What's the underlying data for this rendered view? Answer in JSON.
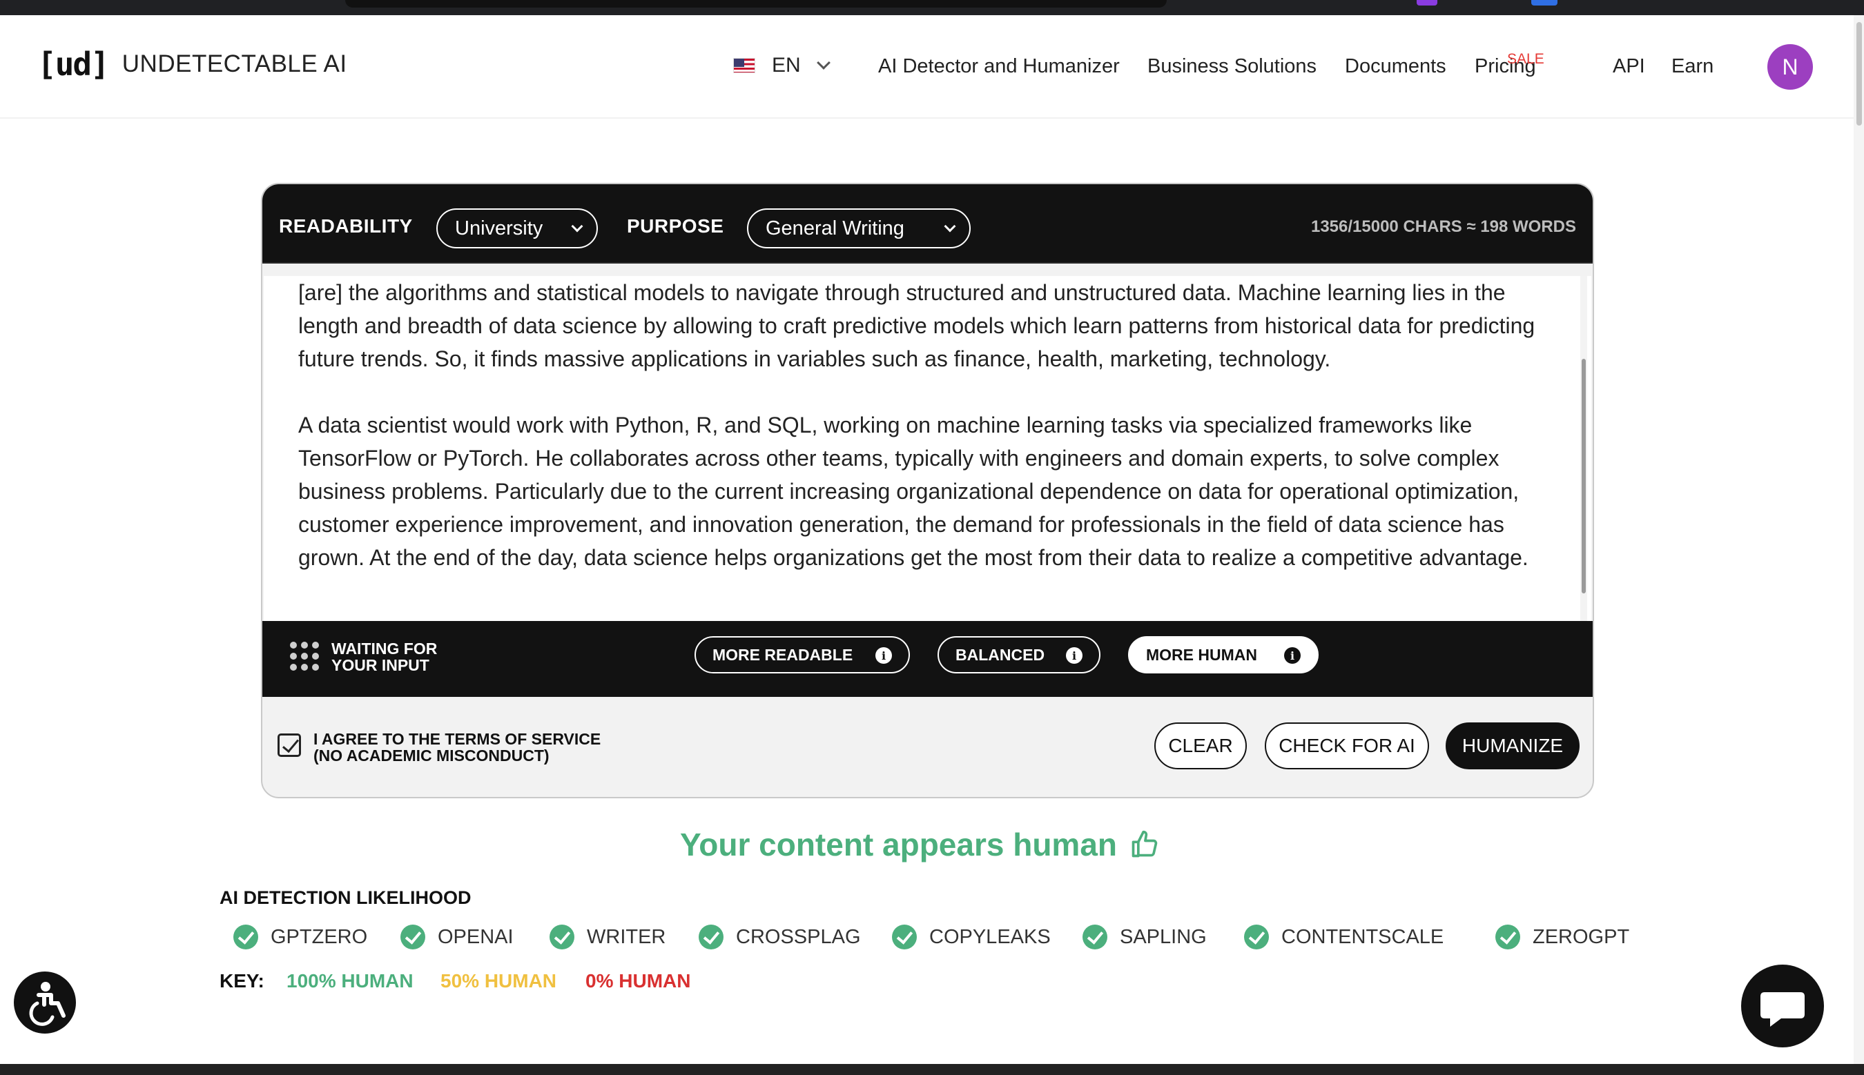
{
  "brand": {
    "mark": "[ud]",
    "name": "UNDETECTABLE AI"
  },
  "language": {
    "code": "EN",
    "flag": "us-flag"
  },
  "nav": {
    "items": [
      "AI Detector and Humanizer",
      "Business Solutions",
      "Documents",
      "Pricing",
      "API",
      "Earn"
    ],
    "sale_badge": "SALE",
    "avatar_initial": "N"
  },
  "editor": {
    "readability_label": "READABILITY",
    "readability_value": "University",
    "purpose_label": "PURPOSE",
    "purpose_value": "General Writing",
    "char_count": "1356/15000 CHARS ≈ 198 WORDS",
    "paragraphs": [
      "[are] the algorithms and statistical models to navigate through structured and unstructured data. Machine learning lies in the length and breadth of data science by allowing to craft predictive models which learn patterns from historical data for predicting future trends. So, it finds massive applications in variables such as finance, health, marketing, technology.",
      "A data scientist would work with Python, R, and SQL, working on machine learning tasks via specialized frameworks like TensorFlow or PyTorch. He collaborates across other teams, typically with engineers and domain experts, to solve complex business problems. Particularly due to the current increasing organizational dependence on data for operational optimization, customer experience improvement, and innovation generation, the demand for professionals in the field of data science has grown. At the end of the day, data science helps organizations get the most from their data to realize a competitive advantage."
    ]
  },
  "status": {
    "line1": "WAITING FOR",
    "line2": "YOUR INPUT"
  },
  "modes": [
    {
      "label": "MORE READABLE",
      "active": false
    },
    {
      "label": "BALANCED",
      "active": false
    },
    {
      "label": "MORE HUMAN",
      "active": true
    }
  ],
  "terms": {
    "line1": "I AGREE TO THE TERMS OF SERVICE",
    "line2": "(NO ACADEMIC MISCONDUCT)",
    "checked": true
  },
  "actions": {
    "clear": "CLEAR",
    "check": "CHECK FOR AI",
    "humanize": "HUMANIZE"
  },
  "result": {
    "verdict": "Your content appears human",
    "detection_title": "AI DETECTION LIKELIHOOD",
    "detectors": [
      "GPTZERO",
      "OPENAI",
      "WRITER",
      "CROSSPLAG",
      "COPYLEAKS",
      "SAPLING",
      "CONTENTSCALE",
      "ZEROGPT"
    ]
  },
  "key": {
    "label": "KEY:",
    "human100": "100% HUMAN",
    "human50": "50% HUMAN",
    "human0": "0% HUMAN"
  },
  "colors": {
    "accent_green": "#4caf7d",
    "amber": "#f0c040",
    "red": "#d93030",
    "avatar": "#9c3fc0",
    "sale": "#e53935"
  }
}
